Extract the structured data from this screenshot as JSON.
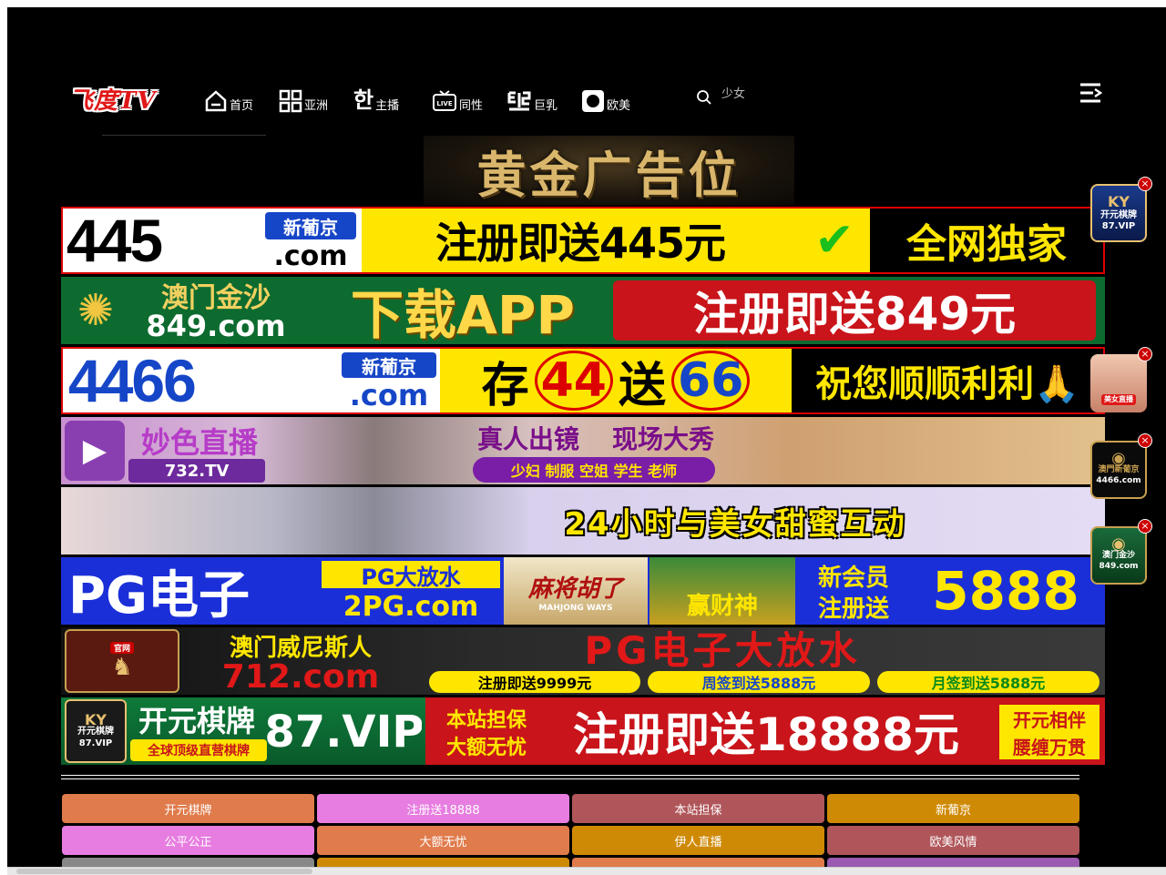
{
  "header": {
    "logo_text": "飞度TV",
    "nav": [
      {
        "label": "首页",
        "icon": "home-icon"
      },
      {
        "label": "亚洲",
        "icon": "grid-icon"
      },
      {
        "label": "主播",
        "icon": "hangul-icon",
        "icon_glyph": "한"
      },
      {
        "label": "同性",
        "icon": "live-tv-icon",
        "icon_glyph": "LIVE"
      },
      {
        "label": "巨乳",
        "icon": "korean-icon"
      },
      {
        "label": "欧美",
        "icon": "circle-square-icon"
      }
    ],
    "search": {
      "placeholder": "少女"
    }
  },
  "gold_banner": {
    "text": "黄金广告位"
  },
  "ads": [
    {
      "id": "ad-445",
      "segments": [
        "445",
        "新葡京",
        ".com",
        "注册即送445元",
        "✔",
        "全网独家"
      ]
    },
    {
      "id": "ad-849",
      "segments": [
        "澳门金沙",
        "849.com",
        "下载APP",
        "注册即送849元"
      ]
    },
    {
      "id": "ad-4466",
      "segments": [
        "4466",
        "新葡京",
        ".com",
        "存",
        "44",
        "送",
        "66",
        "祝您顺顺利利🙏"
      ]
    },
    {
      "id": "ad-732",
      "segments": [
        "妙色直播",
        "732.TV",
        "真人出镜",
        "现场大秀",
        "少妇 制服 空姐 学生 老师"
      ]
    },
    {
      "id": "ad-24h",
      "segments": [
        "24小时与美女甜蜜互动"
      ]
    },
    {
      "id": "ad-pg",
      "segments": [
        "PG电子",
        "PG大放水",
        "2PG.com",
        "麻将胡了",
        "MAHJONG WAYS",
        "赢财神",
        "新会员",
        "注册送",
        "5888"
      ]
    },
    {
      "id": "ad-712",
      "segments": [
        "官网",
        "澳门威尼斯人",
        "712.com",
        "PG电子大放水",
        "注册即送9999元",
        "周签到送5888元",
        "月签到送5888元"
      ]
    },
    {
      "id": "ad-87",
      "segments": [
        "KY",
        "开元棋牌",
        "87.VIP",
        "开元棋牌",
        "87.VIP",
        "全球顶级直营棋牌",
        "本站担保",
        "大额无忧",
        "注册即送18888元",
        "开元相伴",
        "腰缠万贯"
      ]
    }
  ],
  "floats": [
    {
      "line1": "KY",
      "line2": "开元棋牌",
      "line3": "87.VIP"
    },
    {
      "line1": "美女直播",
      "line2": "",
      "line3": ""
    },
    {
      "line1": "澳門新葡京",
      "line2": "4466.com",
      "line3": ""
    },
    {
      "line1": "澳门金沙",
      "line2": "849.com",
      "line3": ""
    }
  ],
  "links": [
    {
      "label": "开元棋牌",
      "color": "#e07b4c"
    },
    {
      "label": "注册送18888",
      "color": "#e77de0"
    },
    {
      "label": "本站担保",
      "color": "#b0565a"
    },
    {
      "label": "新葡京",
      "color": "#cf8a05"
    },
    {
      "label": "公平公正",
      "color": "#e77de0"
    },
    {
      "label": "大额无忧",
      "color": "#e07b4c"
    },
    {
      "label": "伊人直播",
      "color": "#cf8a05"
    },
    {
      "label": "欧美风情",
      "color": "#b0565a"
    },
    {
      "label": "",
      "color": "#888888"
    },
    {
      "label": "",
      "color": "#cf8a05"
    },
    {
      "label": "",
      "color": "#e07b4c"
    },
    {
      "label": "",
      "color": "#9a5ab0"
    }
  ]
}
